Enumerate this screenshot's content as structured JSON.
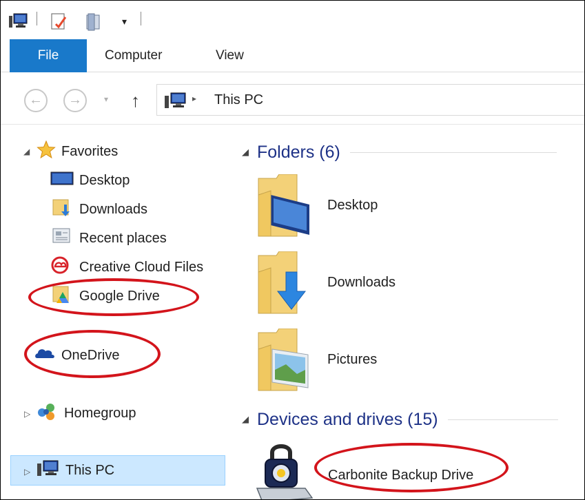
{
  "quick_access": {
    "icons": [
      "computer-icon",
      "properties-icon",
      "new-folder-icon",
      "customize-dropdown-icon"
    ],
    "dropdown_glyph": "▾"
  },
  "ribbon": {
    "tabs": [
      {
        "label": "File"
      },
      {
        "label": "Computer"
      },
      {
        "label": "View"
      }
    ]
  },
  "address_bar": {
    "back_glyph": "←",
    "forward_glyph": "→",
    "recent_glyph": "▾",
    "up_glyph": "↑",
    "separator_glyph": "▸",
    "breadcrumb": "This PC"
  },
  "nav_pane": {
    "favorites": {
      "label": "Favorites",
      "expanded_glyph": "◢",
      "items": [
        {
          "label": "Desktop",
          "icon": "desktop-icon"
        },
        {
          "label": "Downloads",
          "icon": "downloads-icon"
        },
        {
          "label": "Recent places",
          "icon": "recent-places-icon"
        },
        {
          "label": "Creative Cloud Files",
          "icon": "creative-cloud-icon"
        },
        {
          "label": "Google Drive",
          "icon": "google-drive-icon"
        }
      ]
    },
    "onedrive": {
      "label": "OneDrive",
      "icon": "onedrive-icon"
    },
    "homegroup": {
      "label": "Homegroup",
      "icon": "homegroup-icon",
      "collapsed_glyph": "▷"
    },
    "this_pc": {
      "label": "This PC",
      "icon": "this-pc-icon",
      "collapsed_glyph": "▷"
    }
  },
  "content": {
    "folders_group": {
      "title": "Folders (6)",
      "glyph": "◢",
      "items": [
        {
          "label": "Desktop",
          "icon": "desktop-folder-icon"
        },
        {
          "label": "Downloads",
          "icon": "downloads-folder-icon"
        },
        {
          "label": "Pictures",
          "icon": "pictures-folder-icon"
        }
      ]
    },
    "devices_group": {
      "title": "Devices and drives (15)",
      "glyph": "◢",
      "items": [
        {
          "label": "Carbonite Backup Drive",
          "icon": "carbonite-drive-icon"
        }
      ]
    }
  },
  "colors": {
    "accent": "#1979ca",
    "selection": "#cce8ff",
    "group_title": "#1e3287",
    "annotation": "#d3141b",
    "folder_yellow": "#f3d178"
  }
}
